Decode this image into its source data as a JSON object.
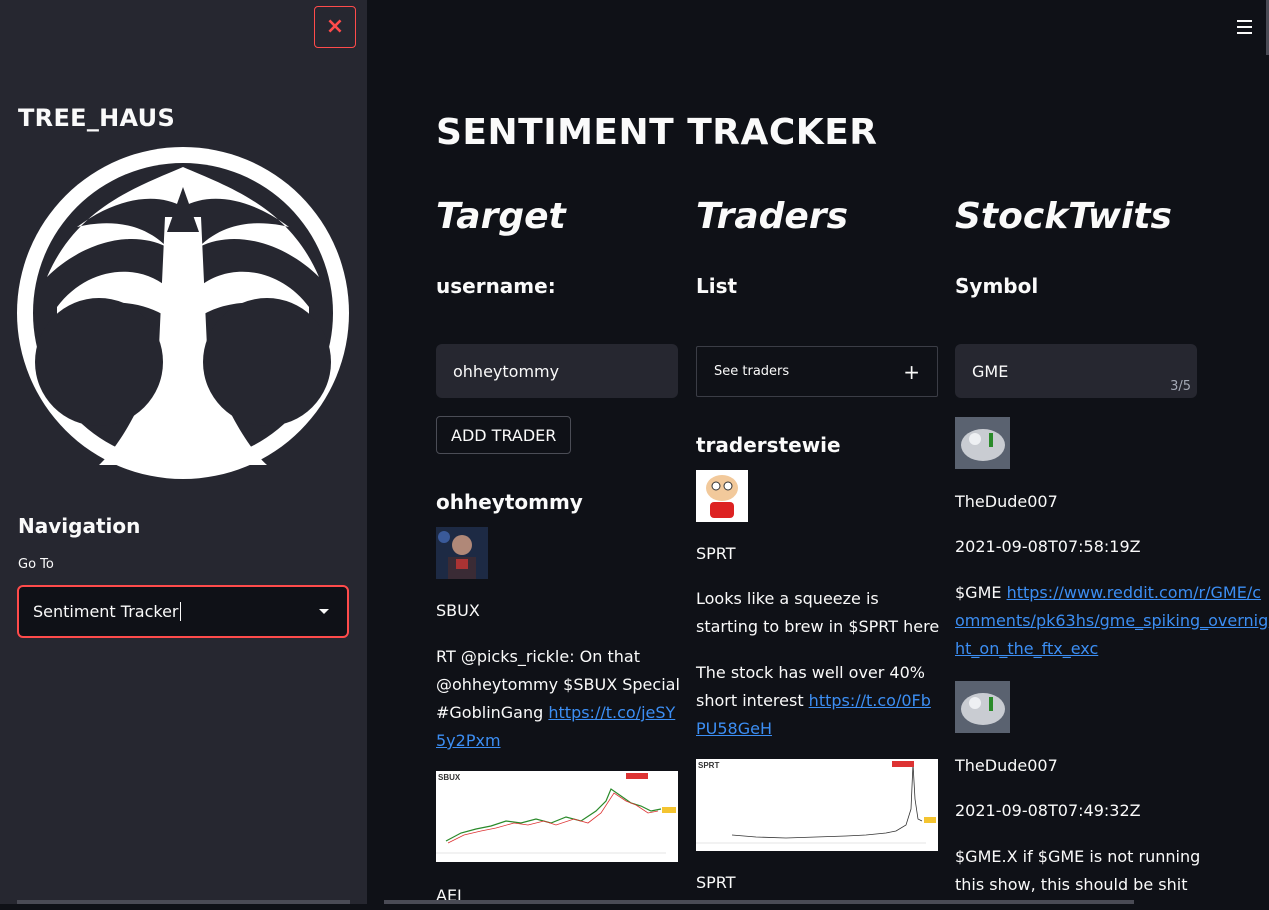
{
  "sidebar": {
    "close_icon": "×",
    "brand": "TREE_HAUS",
    "nav_title": "Navigation",
    "goto_label": "Go To",
    "select_value": "Sentiment Tracker"
  },
  "main": {
    "title": "SENTIMENT TRACKER",
    "target": {
      "heading": "Target",
      "subheading": "username:",
      "input_value": "ohheytommy",
      "add_button": "ADD TRADER",
      "post": {
        "user": "ohheytommy",
        "symbol": "SBUX",
        "text": "RT @picks_rickle: On that @ohheytommy $SBUX Special #GoblinGang ",
        "link": "https://t.co/jeSY5y2Pxm",
        "chart_label": "SBUX",
        "next_symbol": "AEI"
      }
    },
    "traders": {
      "heading": "Traders",
      "subheading": "List",
      "expander_label": "See traders",
      "expander_icon": "+",
      "post": {
        "user": "traderstewie",
        "symbol": "SPRT",
        "text1": "Looks like a squeeze is starting to brew in $SPRT here",
        "text2": "The stock has well over 40% short interest ",
        "link": "https://t.co/0FbPU58GeH",
        "chart_label": "SPRT",
        "next_symbol": "SPRT"
      }
    },
    "stocktwits": {
      "heading": "StockTwits",
      "subheading": "Symbol",
      "input_value": "GME",
      "counter": "3/5",
      "posts": [
        {
          "user": "TheDude007",
          "time": "2021-09-08T07:58:19Z",
          "text": "$GME ",
          "link": "https://www.reddit.com/r/GME/comments/pk63hs/gme_spiking_overnight_on_the_ftx_exc"
        },
        {
          "user": "TheDude007",
          "time": "2021-09-08T07:49:32Z",
          "text": "$GME.X if $GME is not running this show, this should be shit"
        }
      ]
    }
  },
  "colors": {
    "accent": "#ff4b4b",
    "link": "#3c8ef3",
    "sidebar_bg": "#262730",
    "main_bg": "#0f1117"
  }
}
